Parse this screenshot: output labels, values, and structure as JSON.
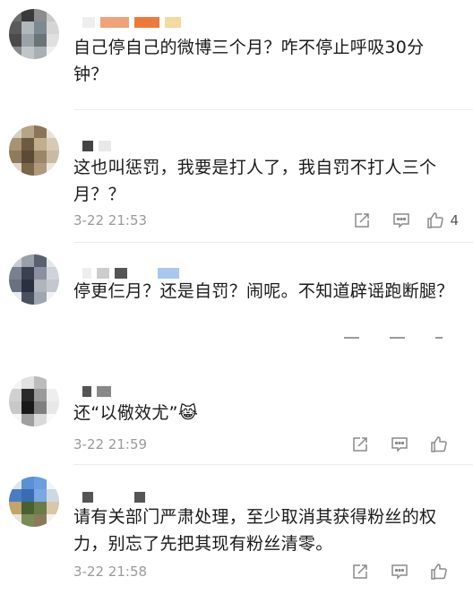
{
  "comments": [
    {
      "text": "自己停自己的微博三个月？咋不停止呼吸30分钟？",
      "time": "",
      "likes": ""
    },
    {
      "text": "这也叫惩罚，我要是打人了，我自罚不打人三个月？？",
      "time": "3-22 21:53",
      "likes": "4"
    },
    {
      "text": "停更仨月？还是自罚？闹呢。不知道辟谣跑断腿？",
      "time": "",
      "likes": ""
    },
    {
      "text": "还“以儆效尤”",
      "emoji": "😹",
      "time": "3-22 21:59",
      "likes": ""
    },
    {
      "text": "请有关部门严肃处理，至少取消其获得粉丝的权力，别忘了先把其现有粉丝清零。",
      "time": "3-22 21:58",
      "likes": ""
    }
  ],
  "icons": {
    "share": "share-icon",
    "comment": "comment-icon",
    "like": "thumbs-up-icon"
  },
  "colors": {
    "text": "#1a1a1a",
    "meta": "#9a9a9a",
    "divider": "#ececec",
    "icon": "#8a8a8a"
  }
}
